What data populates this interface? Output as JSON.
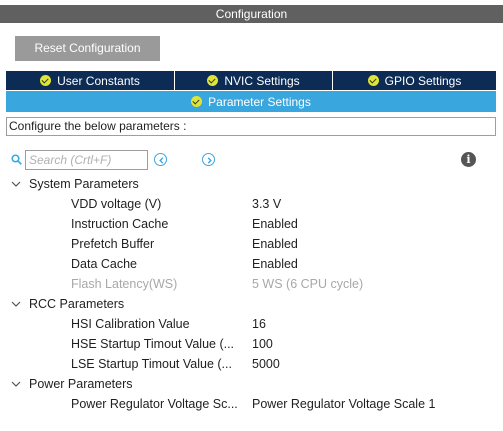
{
  "header": {
    "title": "Configuration"
  },
  "toolbar": {
    "reset_label": "Reset Configuration"
  },
  "tabs": [
    {
      "label": "User Constants"
    },
    {
      "label": "NVIC Settings"
    },
    {
      "label": "GPIO Settings"
    }
  ],
  "active_tab": {
    "label": "Parameter Settings"
  },
  "description": "Configure the below parameters :",
  "search": {
    "placeholder": "Search (Crtl+F)"
  },
  "groups": [
    {
      "label": "System Parameters",
      "params": [
        {
          "name": "VDD voltage (V)",
          "value": "3.3 V"
        },
        {
          "name": "Instruction Cache",
          "value": "Enabled"
        },
        {
          "name": "Prefetch Buffer",
          "value": "Enabled"
        },
        {
          "name": "Data Cache",
          "value": "Enabled"
        },
        {
          "name": "Flash Latency(WS)",
          "value": "5 WS (6 CPU cycle)",
          "disabled": true
        }
      ]
    },
    {
      "label": "RCC Parameters",
      "params": [
        {
          "name": "HSI Calibration Value",
          "value": "16"
        },
        {
          "name": "HSE Startup Timout Value (...",
          "value": "100"
        },
        {
          "name": "LSE Startup Timout Value (...",
          "value": "5000"
        }
      ]
    },
    {
      "label": "Power Parameters",
      "params": [
        {
          "name": "Power Regulator Voltage Sc...",
          "value": "Power Regulator Voltage Scale 1"
        }
      ]
    }
  ],
  "colors": {
    "title_bar": "#606060",
    "tab_bar": "#0c2c55",
    "active_tab": "#3aa6de",
    "check": "#e0e43a",
    "disabled_text": "#a8a8a8"
  }
}
